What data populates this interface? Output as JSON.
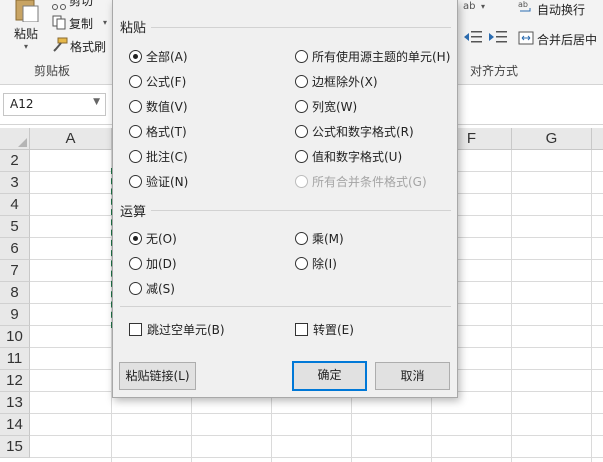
{
  "ribbon": {
    "paste_label": "粘贴",
    "cut_label": "剪切",
    "copy_label": "复制",
    "format_painter_label": "格式刷",
    "clipboard_group": "剪贴板",
    "wrap_text_label": "自动换行",
    "merge_center_label": "合并后居中",
    "alignment_group": "对齐方式"
  },
  "formula_bar": {
    "name_box": "A12"
  },
  "sheet": {
    "columns": [
      "A",
      "F",
      "G"
    ],
    "rows": [
      "2",
      "3",
      "4",
      "5",
      "6",
      "7",
      "8",
      "9",
      "10",
      "11",
      "12",
      "13",
      "14",
      "15"
    ]
  },
  "dialog": {
    "paste_section": "粘贴",
    "paste_options": [
      "全部(A)",
      "公式(F)",
      "数值(V)",
      "格式(T)",
      "批注(C)",
      "验证(N)",
      "所有使用源主题的单元(H)",
      "边框除外(X)",
      "列宽(W)",
      "公式和数字格式(R)",
      "值和数字格式(U)",
      "所有合并条件格式(G)"
    ],
    "paste_selected": "全部(A)",
    "operation_section": "运算",
    "operation_options": [
      "无(O)",
      "加(D)",
      "减(S)",
      "乘(M)",
      "除(I)"
    ],
    "operation_selected": "无(O)",
    "skip_blanks_label": "跳过空单元(B)",
    "transpose_label": "转置(E)",
    "paste_link_label": "粘贴链接(L)",
    "ok_label": "确定",
    "cancel_label": "取消"
  }
}
